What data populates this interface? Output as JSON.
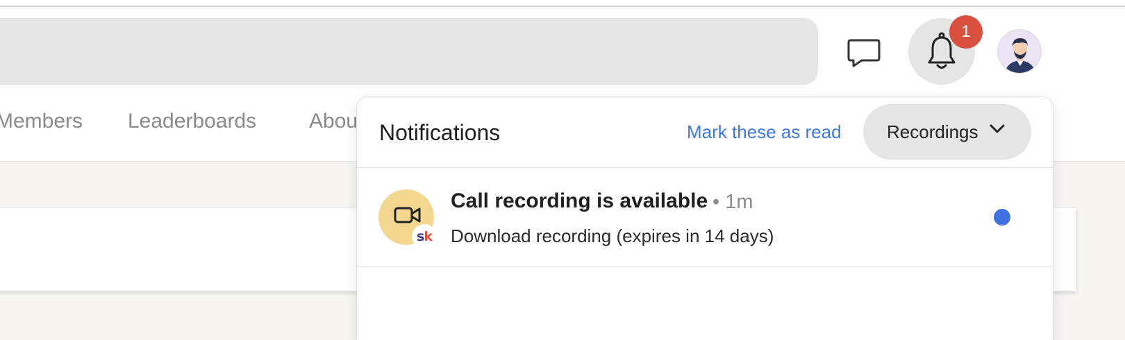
{
  "header": {
    "notifications_badge": "1"
  },
  "nav": {
    "tabs": [
      {
        "label": "Members"
      },
      {
        "label": "Leaderboards"
      },
      {
        "label": "About"
      }
    ]
  },
  "notifications_panel": {
    "title": "Notifications",
    "mark_read_label": "Mark these as read",
    "filter": {
      "selected": "Recordings"
    },
    "items": [
      {
        "title": "Call recording is available",
        "time": "• 1m",
        "body": "Download recording (expires in 14 days)",
        "icon": "video-camera-icon",
        "app_badge": {
          "s": "s",
          "k": "k"
        },
        "unread": true
      }
    ]
  },
  "colors": {
    "badge_red": "#d9503f",
    "link_blue": "#3f78e6",
    "unread_dot": "#4171e3",
    "icon_bg": "#f3d690"
  }
}
